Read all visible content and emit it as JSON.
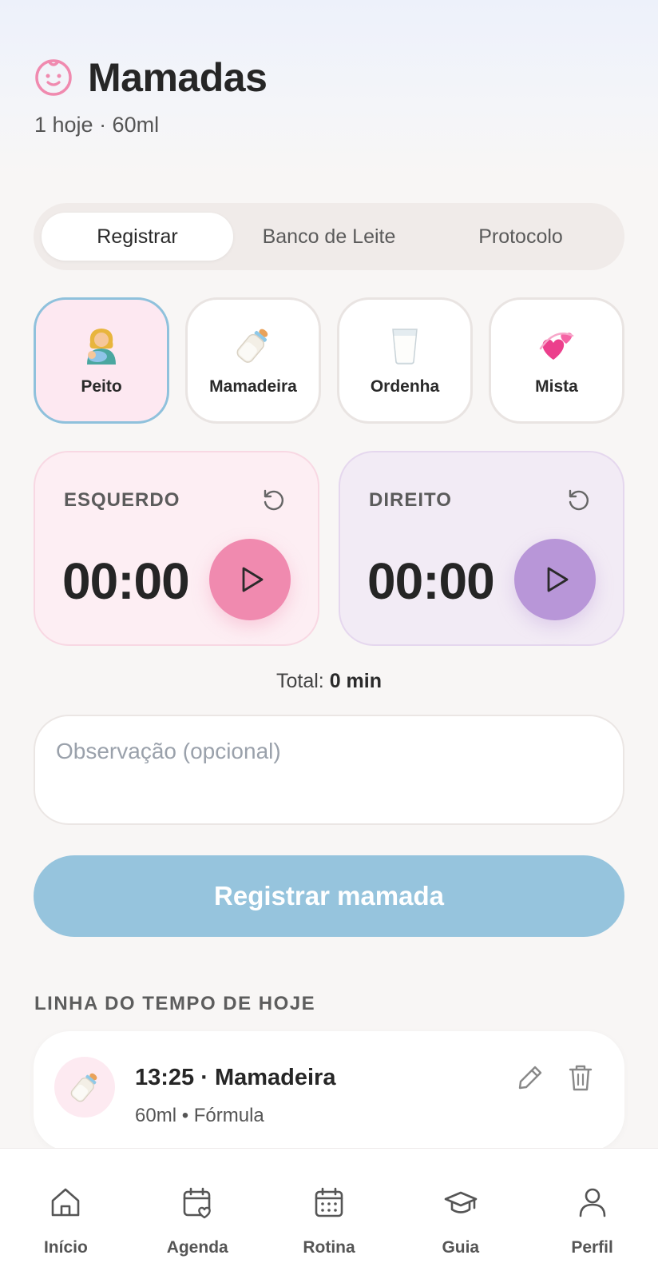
{
  "header": {
    "title": "Mamadas",
    "subtitle": "1 hoje · 60ml",
    "icon": "baby-face-icon"
  },
  "tabs": [
    {
      "label": "Registrar",
      "active": true
    },
    {
      "label": "Banco de Leite",
      "active": false
    },
    {
      "label": "Protocolo",
      "active": false
    }
  ],
  "types": [
    {
      "label": "Peito",
      "icon": "breastfeeding-emoji",
      "selected": true
    },
    {
      "label": "Mamadeira",
      "icon": "baby-bottle-emoji",
      "selected": false
    },
    {
      "label": "Ordenha",
      "icon": "glass-of-milk-emoji",
      "selected": false
    },
    {
      "label": "Mista",
      "icon": "revolving-hearts-emoji",
      "selected": false
    }
  ],
  "timers": {
    "left": {
      "label": "ESQUERDO",
      "time": "00:00",
      "color": "#f08aaf"
    },
    "right": {
      "label": "DIREITO",
      "time": "00:00",
      "color": "#b896d8"
    }
  },
  "total": {
    "label": "Total:",
    "value": "0 min"
  },
  "note": {
    "placeholder": "Observação (opcional)",
    "value": ""
  },
  "submit": {
    "label": "Registrar mamada",
    "color": "#96c4dd"
  },
  "timeline": {
    "title": "LINHA DO TEMPO DE HOJE",
    "entries": [
      {
        "title": "13:25 · Mamadeira",
        "subtitle": "60ml • Fórmula",
        "icon": "baby-bottle-emoji"
      }
    ]
  },
  "nav": [
    {
      "label": "Início",
      "icon": "home-icon"
    },
    {
      "label": "Agenda",
      "icon": "calendar-heart-icon"
    },
    {
      "label": "Rotina",
      "icon": "calendar-grid-icon"
    },
    {
      "label": "Guia",
      "icon": "graduation-cap-icon"
    },
    {
      "label": "Perfil",
      "icon": "user-icon"
    }
  ]
}
